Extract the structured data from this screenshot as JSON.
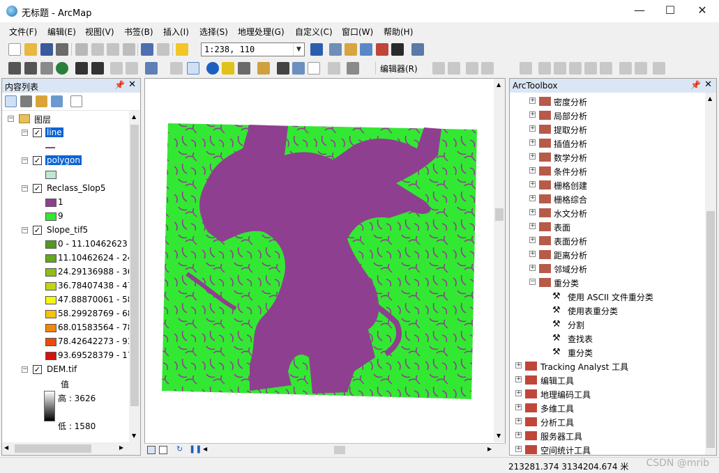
{
  "window": {
    "title": "无标题 - ArcMap",
    "minimize": "—",
    "maximize": "☐",
    "close": "✕"
  },
  "menu": [
    "文件(F)",
    "编辑(E)",
    "视图(V)",
    "书签(B)",
    "插入(I)",
    "选择(S)",
    "地理处理(G)",
    "自定义(C)",
    "窗口(W)",
    "帮助(H)"
  ],
  "toolbar": {
    "scale_value": "1:238, 110",
    "editor_label": "编辑器(R)"
  },
  "toc": {
    "title": "内容列表",
    "root_label": "图层",
    "layers": {
      "line": {
        "name": "line"
      },
      "polygon": {
        "name": "polygon"
      },
      "reclass": {
        "name": "Reclass_Slop5",
        "classes": [
          {
            "label": "1",
            "color": "#8f3f8f"
          },
          {
            "label": "9",
            "color": "#33e833"
          }
        ]
      },
      "slope": {
        "name": "Slope_tif5",
        "classes": [
          {
            "label": "0 - 11.10462623",
            "color": "#4f9a1f"
          },
          {
            "label": "11.10462624 - 24.",
            "color": "#63a81e"
          },
          {
            "label": "24.29136988 - 36.",
            "color": "#8fbd1a"
          },
          {
            "label": "36.78407438 - 47.",
            "color": "#c2d414"
          },
          {
            "label": "47.88870061 - 58.",
            "color": "#f5f50f"
          },
          {
            "label": "58.29928769 - 68.",
            "color": "#f8c10d"
          },
          {
            "label": "68.01583564 - 78.",
            "color": "#f4860b"
          },
          {
            "label": "78.42642273 - 93.",
            "color": "#ea4a0a"
          },
          {
            "label": "93.69528379 - 17(",
            "color": "#d5120c"
          }
        ]
      },
      "dem": {
        "name": "DEM.tif",
        "value_label": "值",
        "high": "高 : 3626",
        "low": "低 : 1580"
      }
    }
  },
  "toolbox": {
    "title": "ArcToolbox",
    "toolsets": [
      "密度分析",
      "局部分析",
      "提取分析",
      "插值分析",
      "数学分析",
      "条件分析",
      "栅格创建",
      "栅格综合",
      "水文分析",
      "表面",
      "表面分析",
      "距离分析",
      "邻域分析"
    ],
    "open_toolset": "重分类",
    "tools": [
      "使用 ASCII 文件重分类",
      "使用表重分类",
      "分割",
      "查找表",
      "重分类"
    ],
    "toolboxes": [
      "Tracking Analyst 工具",
      "编辑工具",
      "地理编码工具",
      "多维工具",
      "分析工具",
      "服务器工具",
      "空间统计工具"
    ]
  },
  "status": {
    "coordinates": "213281.374  3134204.674 米",
    "watermark": "CSDN @mrib"
  },
  "colors": {
    "purple": "#8f3f8f",
    "green": "#33e833",
    "selection": "#0a64d6"
  }
}
